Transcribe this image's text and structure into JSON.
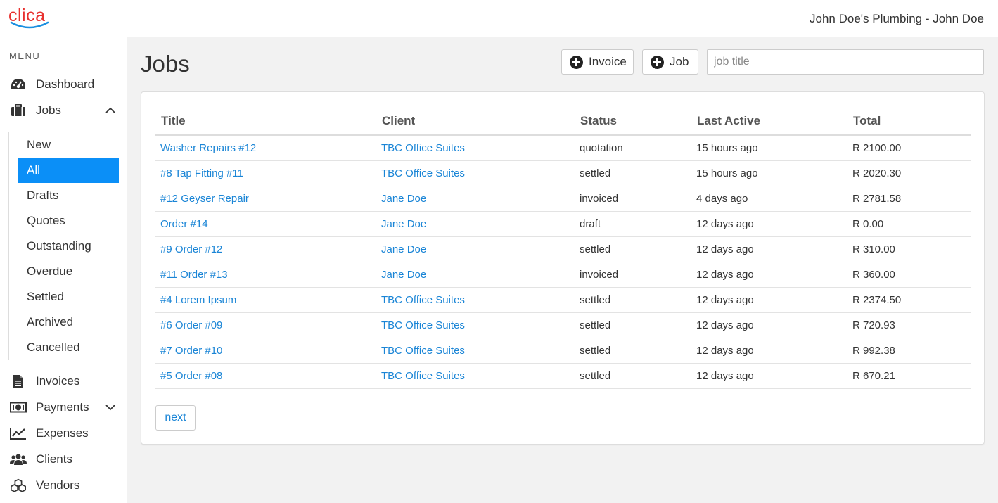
{
  "brand": {
    "logo_text": "clica",
    "logo_color": "#e8312f",
    "accent_color": "#0b8ff7"
  },
  "header": {
    "account": "John Doe's Plumbing - John Doe"
  },
  "sidebar": {
    "heading": "MENU",
    "items": [
      {
        "label": "Dashboard",
        "icon": "dashboard-icon"
      },
      {
        "label": "Jobs",
        "icon": "briefcase-icon",
        "expanded": true
      },
      {
        "label": "Invoices",
        "icon": "document-icon"
      },
      {
        "label": "Payments",
        "icon": "money-icon",
        "expanded": false
      },
      {
        "label": "Expenses",
        "icon": "line-chart-icon"
      },
      {
        "label": "Clients",
        "icon": "users-icon"
      },
      {
        "label": "Vendors",
        "icon": "cubes-icon"
      }
    ],
    "jobs_submenu": [
      "New",
      "All",
      "Drafts",
      "Quotes",
      "Outstanding",
      "Overdue",
      "Settled",
      "Archived",
      "Cancelled"
    ],
    "active_submenu": "All"
  },
  "main": {
    "title": "Jobs",
    "invoice_button": "Invoice",
    "job_button": "Job",
    "search_placeholder": "job title",
    "columns": [
      "Title",
      "Client",
      "Status",
      "Last Active",
      "Total"
    ],
    "rows": [
      [
        "Washer Repairs #12",
        "TBC Office Suites",
        "quotation",
        "15 hours ago",
        "R 2100.00"
      ],
      [
        "#8 Tap Fitting #11",
        "TBC Office Suites",
        "settled",
        "15 hours ago",
        "R 2020.30"
      ],
      [
        "#12 Geyser Repair",
        "Jane Doe",
        "invoiced",
        "4 days ago",
        "R 2781.58"
      ],
      [
        "Order #14",
        "Jane Doe",
        "draft",
        "12 days ago",
        "R 0.00"
      ],
      [
        "#9 Order #12",
        "Jane Doe",
        "settled",
        "12 days ago",
        "R 310.00"
      ],
      [
        "#11 Order #13",
        "Jane Doe",
        "invoiced",
        "12 days ago",
        "R 360.00"
      ],
      [
        "#4 Lorem Ipsum",
        "TBC Office Suites",
        "settled",
        "12 days ago",
        "R 2374.50"
      ],
      [
        "#6 Order #09",
        "TBC Office Suites",
        "settled",
        "12 days ago",
        "R 720.93"
      ],
      [
        "#7 Order #10",
        "TBC Office Suites",
        "settled",
        "12 days ago",
        "R 992.38"
      ],
      [
        "#5 Order #08",
        "TBC Office Suites",
        "settled",
        "12 days ago",
        "R 670.21"
      ]
    ],
    "next_label": "next"
  }
}
